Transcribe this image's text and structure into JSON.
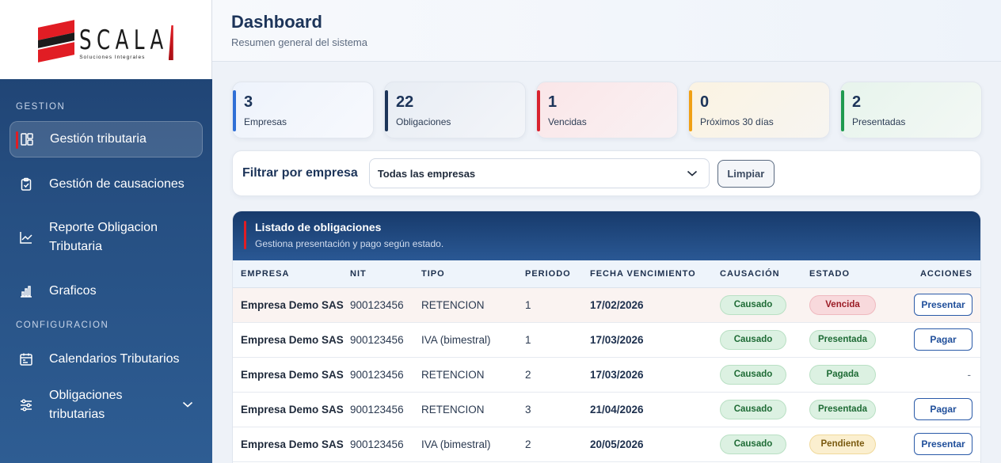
{
  "brand": {
    "name": "SCALA",
    "tagline": "Soluciones Integrales"
  },
  "sidebar": {
    "sections": [
      {
        "label": "GESTION"
      },
      {
        "label": "CONFIGURACION"
      }
    ],
    "items": [
      {
        "label": "Gestión tributaria",
        "icon": "layout-icon",
        "active": true
      },
      {
        "label": "Gestión de causaciones",
        "icon": "clipboard-icon"
      },
      {
        "label": "Reporte Obligacion Tributaria",
        "icon": "chart-line-icon"
      },
      {
        "label": "Graficos",
        "icon": "bar-chart-icon"
      },
      {
        "label": "Calendarios Tributarios",
        "icon": "calendar-icon"
      },
      {
        "label": "Obligaciones tributarias",
        "icon": "sliders-icon",
        "expandable": true
      }
    ]
  },
  "header": {
    "title": "Dashboard",
    "subtitle": "Resumen general del sistema"
  },
  "stats": [
    {
      "value": "3",
      "label": "Empresas",
      "color": "#2f6fd6"
    },
    {
      "value": "22",
      "label": "Obligaciones",
      "color": "#1c3459"
    },
    {
      "value": "1",
      "label": "Vencidas",
      "color": "#d8232f"
    },
    {
      "value": "0",
      "label": "Próximos 30 días",
      "color": "#f0a015"
    },
    {
      "value": "2",
      "label": "Presentadas",
      "color": "#1f9a4f"
    }
  ],
  "filter": {
    "label": "Filtrar por empresa",
    "selected": "Todas las empresas",
    "clear_label": "Limpiar"
  },
  "table": {
    "title": "Listado de obligaciones",
    "subtitle": "Gestiona presentación y pago según estado.",
    "columns": [
      "EMPRESA",
      "NIT",
      "TIPO",
      "PERIODO",
      "FECHA VENCIMIENTO",
      "CAUSACIÓN",
      "ESTADO",
      "ACCIONES"
    ],
    "rows": [
      {
        "empresa": "Empresa Demo SAS",
        "nit": "900123456",
        "tipo": "RETENCION",
        "periodo": "1",
        "fecha": "17/02/2026",
        "causacion": "Causado",
        "estado": "Vencida",
        "estado_tone": "red",
        "accion": "Presentar"
      },
      {
        "empresa": "Empresa Demo SAS",
        "nit": "900123456",
        "tipo": "IVA (bimestral)",
        "periodo": "1",
        "fecha": "17/03/2026",
        "causacion": "Causado",
        "estado": "Presentada",
        "estado_tone": "green",
        "accion": "Pagar"
      },
      {
        "empresa": "Empresa Demo SAS",
        "nit": "900123456",
        "tipo": "RETENCION",
        "periodo": "2",
        "fecha": "17/03/2026",
        "causacion": "Causado",
        "estado": "Pagada",
        "estado_tone": "green",
        "accion": "-"
      },
      {
        "empresa": "Empresa Demo SAS",
        "nit": "900123456",
        "tipo": "RETENCION",
        "periodo": "3",
        "fecha": "21/04/2026",
        "causacion": "Causado",
        "estado": "Presentada",
        "estado_tone": "green",
        "accion": "Pagar"
      },
      {
        "empresa": "Empresa Demo SAS",
        "nit": "900123456",
        "tipo": "IVA (bimestral)",
        "periodo": "2",
        "fecha": "20/05/2026",
        "causacion": "Causado",
        "estado": "Pendiente",
        "estado_tone": "yellow",
        "accion": "Presentar"
      }
    ]
  }
}
